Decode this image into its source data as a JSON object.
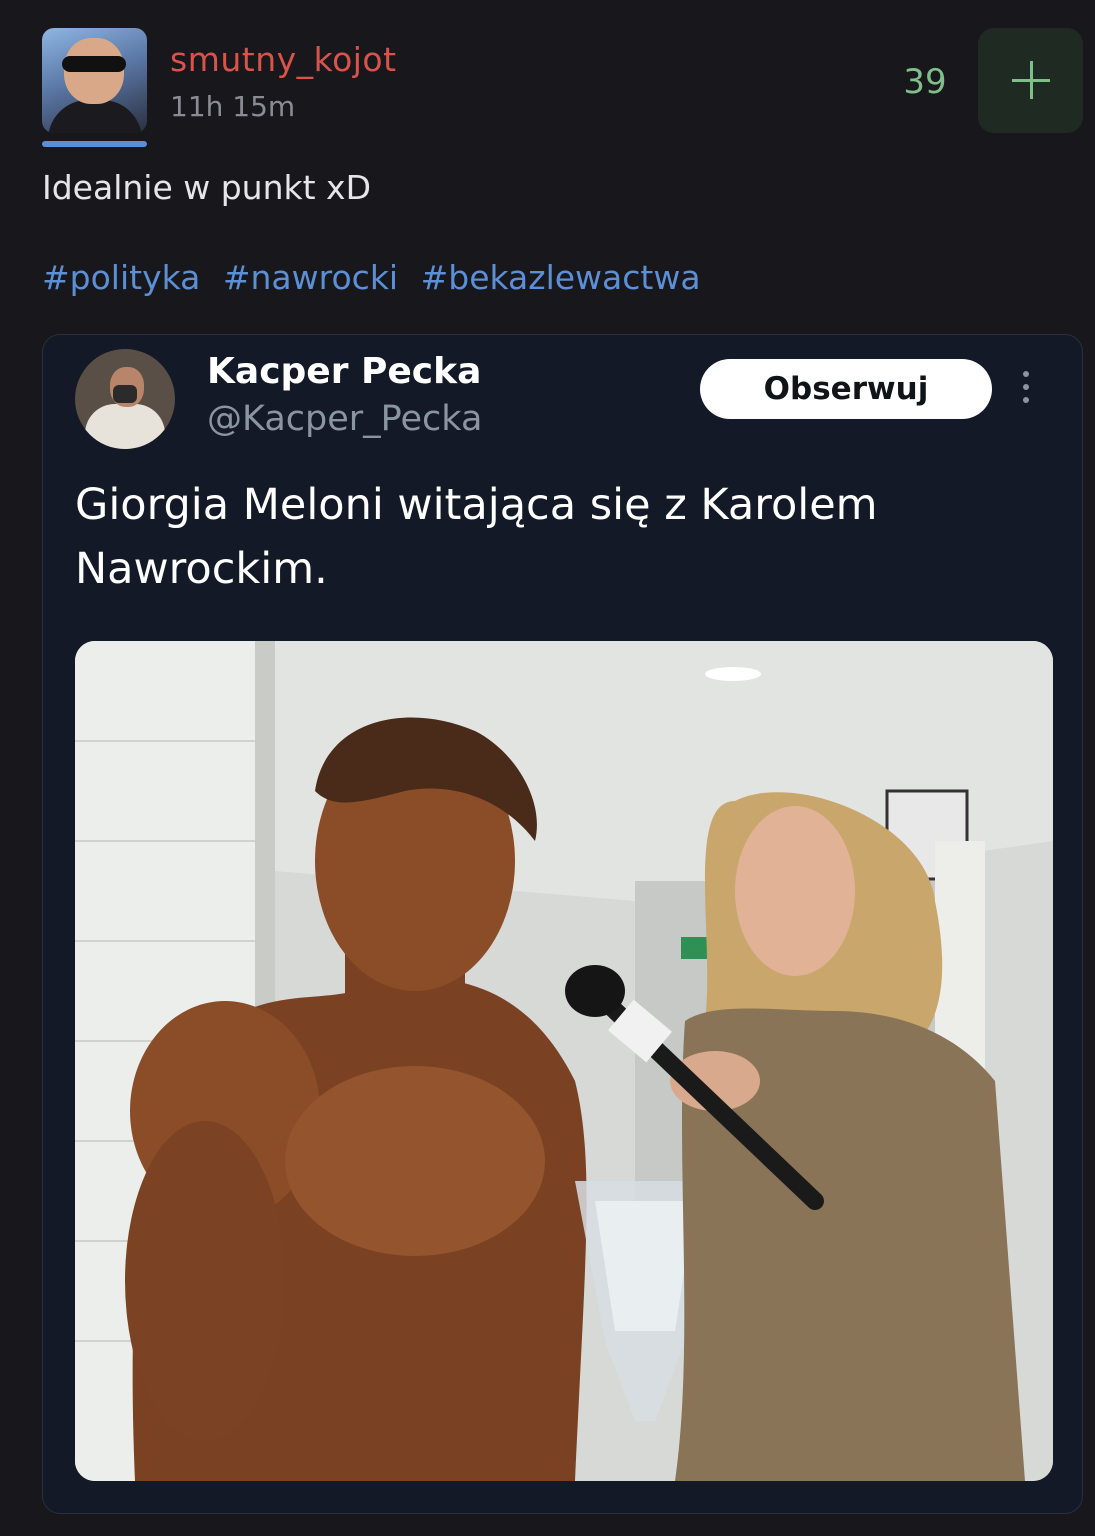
{
  "post": {
    "username": "smutny_kojot",
    "timestamp": "11h 15m",
    "votes": "39",
    "text": "Idealnie w punkt xD",
    "tags": [
      "#polityka",
      "#nawrocki",
      "#bekazlewactwa"
    ]
  },
  "embed": {
    "author_name": "Kacper Pecka",
    "author_handle": "@Kacper_Pecka",
    "follow_label": "Obserwuj",
    "text": "Giorgia Meloni witająca się z Karolem Nawrockim."
  },
  "colors": {
    "background": "#17171c",
    "username": "#d9534b",
    "tag": "#5b8fd6",
    "vote": "#7fc08a",
    "embed_bg": "#131926"
  },
  "icons": {
    "add": "plus-icon",
    "more": "more-vertical-icon"
  }
}
